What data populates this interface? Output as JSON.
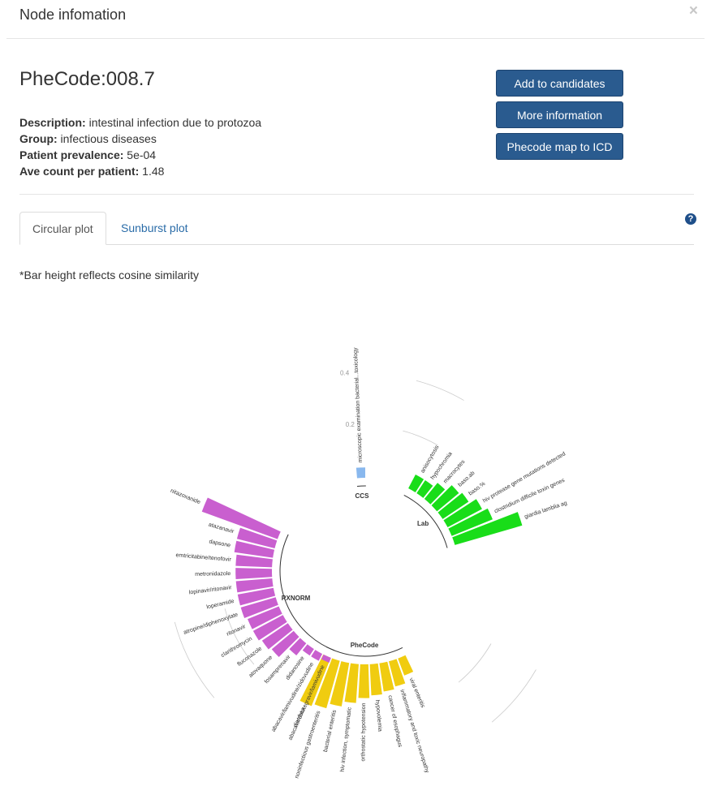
{
  "modal": {
    "title": "Node infomation",
    "close": "×"
  },
  "node": {
    "title": "PheCode:008.7",
    "description_label": "Description:",
    "description": "intestinal infection due to protozoa",
    "group_label": "Group:",
    "group": "infectious diseases",
    "prevalence_label": "Patient prevalence:",
    "prevalence": "5e-04",
    "avecount_label": "Ave count per patient:",
    "avecount": "1.48"
  },
  "buttons": {
    "add": "Add to candidates",
    "more": "More information",
    "map": "Phecode map to ICD"
  },
  "tabs": {
    "circular": "Circular plot",
    "sunburst": "Sunburst plot",
    "help": "?"
  },
  "note": "*Bar height reflects cosine similarity",
  "colors": {
    "CCS": "#89b8ee",
    "Lab": "#19dd19",
    "PheCode": "#f0cc10",
    "RXNORM": "#c95fcf"
  },
  "chart_data": {
    "type": "bar",
    "layout": "circular",
    "ticks": [
      0.2,
      0.4
    ],
    "groups": [
      {
        "name": "CCS",
        "items": [
          {
            "label": "microscopic examination bacterial...toxicology",
            "value": 0.04
          }
        ]
      },
      {
        "name": "Lab",
        "items": [
          {
            "label": "anisocytosis",
            "value": 0.06
          },
          {
            "label": "hypochromia",
            "value": 0.06
          },
          {
            "label": "macrocytes",
            "value": 0.08
          },
          {
            "label": "baso.ab",
            "value": 0.11
          },
          {
            "label": "baso.%",
            "value": 0.12
          },
          {
            "label": "hiv protease gene mutations detected",
            "value": 0.15
          },
          {
            "label": "clostridium difficile toxin genes",
            "value": 0.17
          },
          {
            "label": "giardia lamblia ag",
            "value": 0.27
          }
        ]
      },
      {
        "name": "PheCode",
        "items": [
          {
            "label": "viral enteritis",
            "value": 0.07
          },
          {
            "label": "inflammatory and toxic neuropathy",
            "value": 0.1
          },
          {
            "label": "cancer of esophagus",
            "value": 0.11
          },
          {
            "label": "hypovolemia",
            "value": 0.12
          },
          {
            "label": "orthostatic hypotension",
            "value": 0.13
          },
          {
            "label": "hiv infection, symptomatic",
            "value": 0.15
          },
          {
            "label": "bacterial enteritis",
            "value": 0.17
          },
          {
            "label": "noninfectious gastroenteritis",
            "value": 0.19
          },
          {
            "label": "diarrhea",
            "value": 0.2
          }
        ]
      },
      {
        "name": "RXNORM",
        "items": [
          {
            "label": "abacavir/dolutegravir/lamivudine",
            "value": 0.02
          },
          {
            "label": "abacavir/lamivudine/zidovudine",
            "value": 0.03
          },
          {
            "label": "didanosine",
            "value": 0.03
          },
          {
            "label": "fosamprenavir",
            "value": 0.06
          },
          {
            "label": "atovaquone",
            "value": 0.11
          },
          {
            "label": "fluconazole",
            "value": 0.12
          },
          {
            "label": "clarithromycin",
            "value": 0.13
          },
          {
            "label": "ritonavir",
            "value": 0.13
          },
          {
            "label": "atropine/diphenoxylate",
            "value": 0.14
          },
          {
            "label": "loperamide",
            "value": 0.14
          },
          {
            "label": "lopinavir/ritonavir",
            "value": 0.14
          },
          {
            "label": "metronidazole",
            "value": 0.14
          },
          {
            "label": "emtricitabine/tenofovir",
            "value": 0.14
          },
          {
            "label": "dapsone",
            "value": 0.15
          },
          {
            "label": "atazanavir",
            "value": 0.15
          },
          {
            "label": "nitazoxanide",
            "value": 0.31
          }
        ]
      }
    ]
  }
}
